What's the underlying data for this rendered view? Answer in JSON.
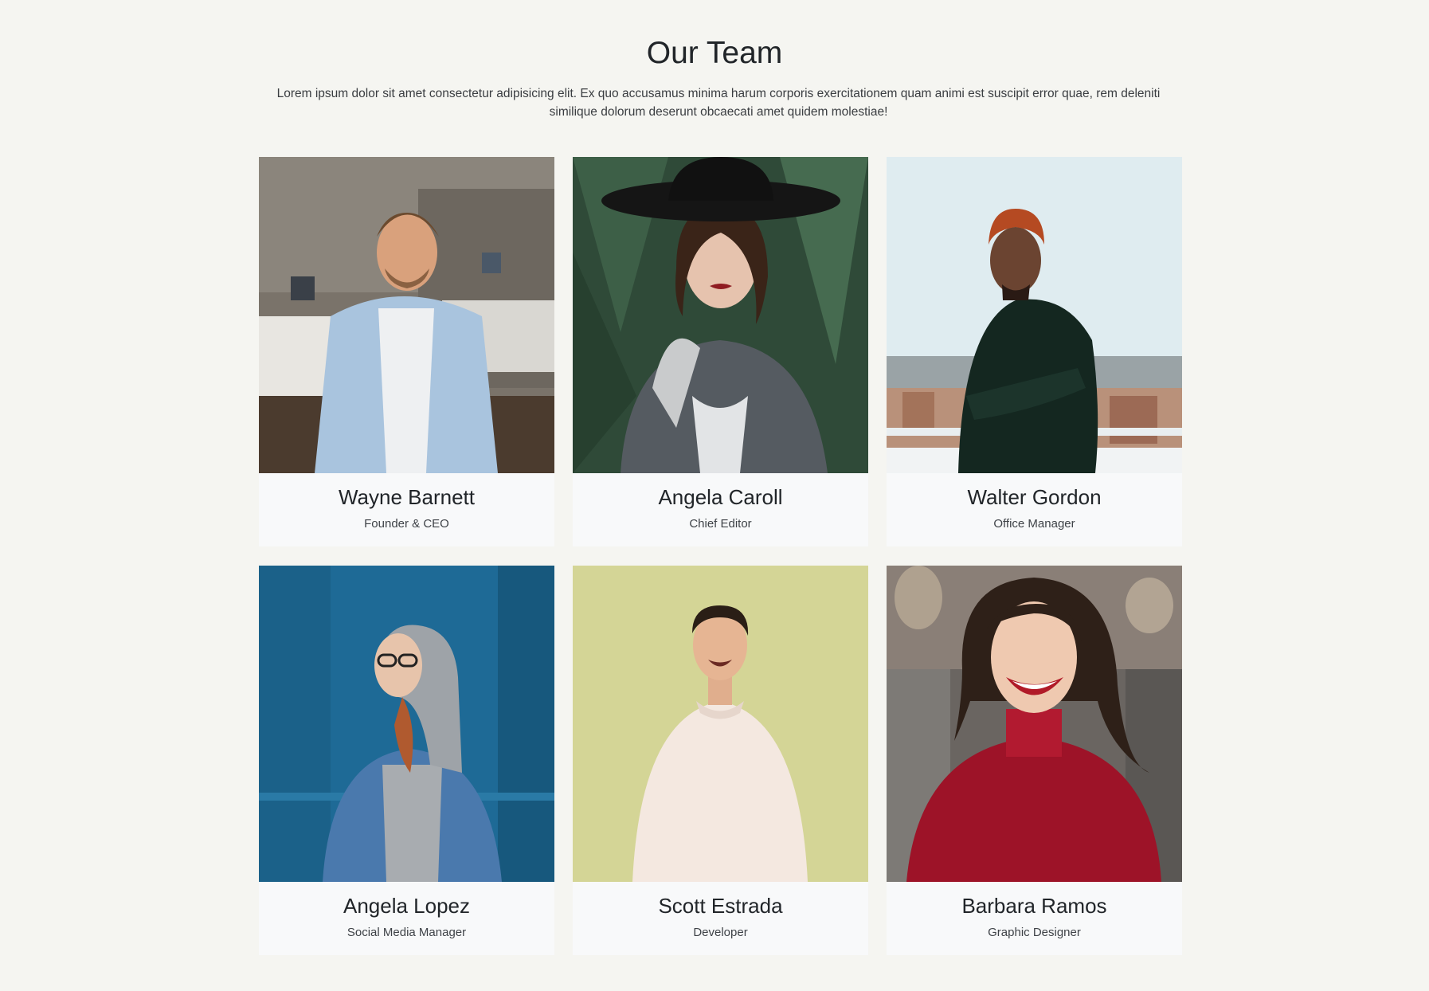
{
  "section": {
    "title": "Our Team",
    "description": "Lorem ipsum dolor sit amet consectetur adipisicing elit. Ex quo accusamus minima harum corporis exercitationem quam animi est suscipit error quae, rem deleniti similique dolorum deserunt obcaecati amet quidem molestiae!"
  },
  "team": [
    {
      "name": "Wayne Barnett",
      "role": "Founder & CEO"
    },
    {
      "name": "Angela Caroll",
      "role": "Chief Editor"
    },
    {
      "name": "Walter Gordon",
      "role": "Office Manager"
    },
    {
      "name": "Angela Lopez",
      "role": "Social Media Manager"
    },
    {
      "name": "Scott Estrada",
      "role": "Developer"
    },
    {
      "name": "Barbara Ramos",
      "role": "Graphic Designer"
    }
  ],
  "colors": {
    "page_background": "#f5f5f1",
    "card_background": "#f8f9fa",
    "text": "#212529"
  }
}
